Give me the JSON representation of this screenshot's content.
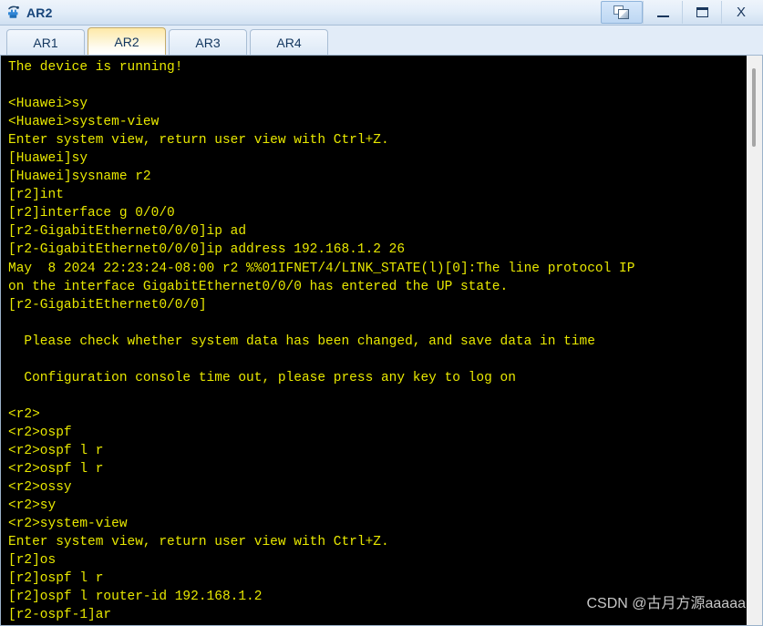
{
  "window": {
    "title": "AR2",
    "icon": "router-device-icon",
    "controls": {
      "panes_label": "",
      "panes_icon": "restore-panes-icon",
      "minimize_label": "",
      "minimize_icon": "minimize-icon",
      "maximize_label": "",
      "maximize_icon": "maximize-icon",
      "close_label": "X",
      "close_icon": "close-icon"
    }
  },
  "tabs": [
    {
      "label": "AR1",
      "active": false
    },
    {
      "label": "AR2",
      "active": true
    },
    {
      "label": "AR3",
      "active": false
    },
    {
      "label": "AR4",
      "active": false
    }
  ],
  "terminal": {
    "foreground_color": "#e8e800",
    "background_color": "#000000",
    "lines": [
      "The device is running!",
      "",
      "<Huawei>sy",
      "<Huawei>system-view",
      "Enter system view, return user view with Ctrl+Z.",
      "[Huawei]sy",
      "[Huawei]sysname r2",
      "[r2]int",
      "[r2]interface g 0/0/0",
      "[r2-GigabitEthernet0/0/0]ip ad",
      "[r2-GigabitEthernet0/0/0]ip address 192.168.1.2 26",
      "May  8 2024 22:23:24-08:00 r2 %%01IFNET/4/LINK_STATE(l)[0]:The line protocol IP",
      "on the interface GigabitEthernet0/0/0 has entered the UP state.",
      "[r2-GigabitEthernet0/0/0]",
      "",
      "  Please check whether system data has been changed, and save data in time",
      "",
      "  Configuration console time out, please press any key to log on",
      "",
      "<r2>",
      "<r2>ospf",
      "<r2>ospf l r",
      "<r2>ospf l r",
      "<r2>ossy",
      "<r2>sy",
      "<r2>system-view",
      "Enter system view, return user view with Ctrl+Z.",
      "[r2]os",
      "[r2]ospf l r",
      "[r2]ospf l router-id 192.168.1.2",
      "[r2-ospf-1]ar"
    ]
  },
  "scrollbar": {
    "orientation": "vertical"
  },
  "watermark": {
    "text": "CSDN @古月方源aaaaa"
  }
}
